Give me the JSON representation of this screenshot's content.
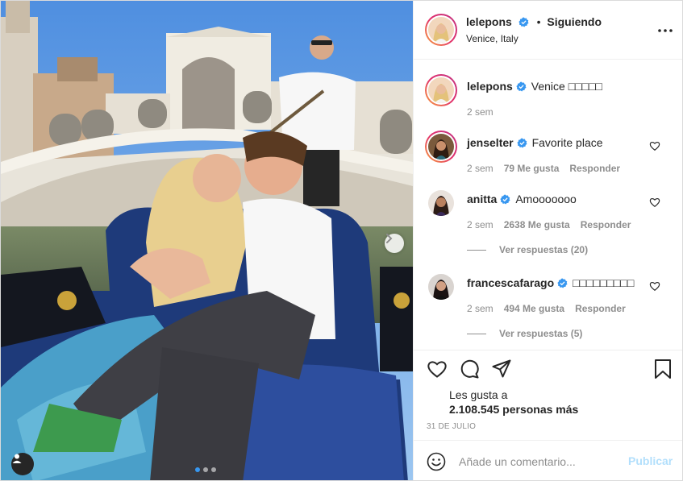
{
  "colors": {
    "accent_blue": "#3797f0",
    "verified_blue": "#3897f0",
    "muted_text": "#8e8e8e",
    "disabled_post": "#b2dffc",
    "text": "#262626"
  },
  "header": {
    "username": "lelepons",
    "separator": "•",
    "follow_status": "Siguiendo",
    "location": "Venice, Italy",
    "icons": {
      "verified": "verified-badge-icon",
      "more": "more-options-icon"
    }
  },
  "photo": {
    "carousel_total": 3,
    "carousel_active_index": 0,
    "icons": {
      "next": "chevron-right-icon",
      "tags": "user-tag-icon"
    }
  },
  "caption": {
    "username": "lelepons",
    "text": "Venice □□□□□",
    "time": "2 sem"
  },
  "comments": [
    {
      "username": "jenselter",
      "text": "Favorite place",
      "time": "2 sem",
      "likes": "79 Me gusta",
      "reply": "Responder",
      "view_replies": ""
    },
    {
      "username": "anitta",
      "text": "Amooooooo",
      "time": "2 sem",
      "likes": "2638 Me gusta",
      "reply": "Responder",
      "view_replies": "Ver respuestas (20)"
    },
    {
      "username": "francescafarago",
      "text": "□□□□□□□□□",
      "time": "2 sem",
      "likes": "494 Me gusta",
      "reply": "Responder",
      "view_replies": "Ver respuestas (5)"
    }
  ],
  "actions": {
    "icons": [
      "heart-icon",
      "comment-icon",
      "share-icon",
      "bookmark-icon"
    ],
    "liked_by_prefix": "Les gusta a",
    "liked_by_count": "2.108.545 personas más",
    "date": "31 DE JULIO"
  },
  "add_comment": {
    "placeholder": "Añade un comentario...",
    "post_label": "Publicar",
    "icon": "emoji-icon"
  }
}
